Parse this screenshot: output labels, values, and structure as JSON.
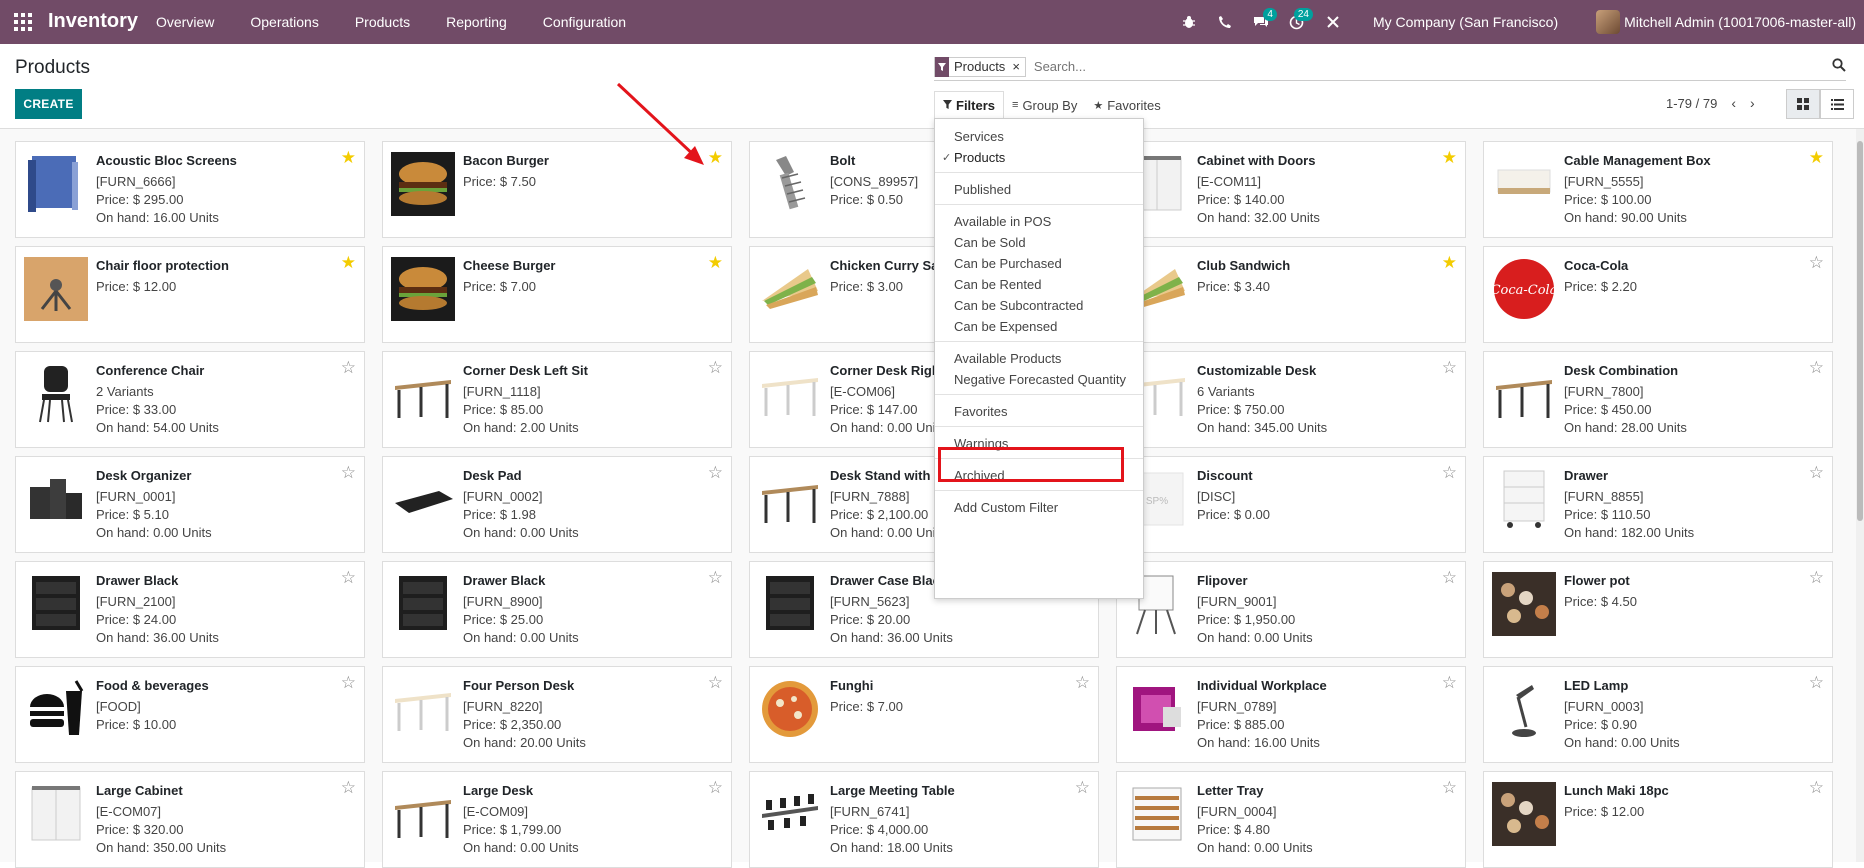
{
  "navbar": {
    "brand": "Inventory",
    "menu": [
      "Overview",
      "Operations",
      "Products",
      "Reporting",
      "Configuration"
    ],
    "badges": {
      "messages": "4",
      "activities": "24"
    },
    "company": "My Company (San Francisco)",
    "user": "Mitchell Admin (10017006-master-all)"
  },
  "page": {
    "title": "Products",
    "create_label": "CREATE"
  },
  "search": {
    "facet": "Products",
    "placeholder": "Search..."
  },
  "filter_bar": {
    "filters": "Filters",
    "group_by": "Group By",
    "favorites": "Favorites"
  },
  "pager": {
    "range": "1-79 / 79"
  },
  "filters_dropdown": {
    "groups": [
      [
        {
          "label": "Services",
          "checked": false
        },
        {
          "label": "Products",
          "checked": true
        }
      ],
      [
        {
          "label": "Published",
          "checked": false
        }
      ],
      [
        {
          "label": "Available in POS",
          "checked": false
        },
        {
          "label": "Can be Sold",
          "checked": false
        },
        {
          "label": "Can be Purchased",
          "checked": false
        },
        {
          "label": "Can be Rented",
          "checked": false
        },
        {
          "label": "Can be Subcontracted",
          "checked": false
        },
        {
          "label": "Can be Expensed",
          "checked": false
        }
      ],
      [
        {
          "label": "Available Products",
          "checked": false
        },
        {
          "label": "Negative Forecasted Quantity",
          "checked": false
        }
      ],
      [
        {
          "label": "Favorites",
          "checked": false
        }
      ],
      [
        {
          "label": "Warnings",
          "checked": false
        }
      ],
      [
        {
          "label": "Archived",
          "checked": false
        }
      ],
      [
        {
          "label": "Add Custom Filter",
          "checked": false
        }
      ]
    ]
  },
  "colors": {
    "navbar": "#714b67",
    "primary": "#017e84",
    "star": "#f3cc00",
    "highlight": "#e3141b"
  },
  "products": [
    [
      {
        "name": "Acoustic Bloc Screens",
        "lines": [
          "[FURN_6666]",
          "Price: $ 295.00",
          "On hand: 16.00 Units"
        ],
        "fav": true,
        "icon": "screen"
      },
      {
        "name": "Bacon Burger",
        "lines": [
          "Price: $ 7.50"
        ],
        "fav": true,
        "icon": "burger"
      },
      {
        "name": "Bolt",
        "lines": [
          "[CONS_89957]",
          "Price: $ 0.50"
        ],
        "fav": false,
        "icon": "bolt"
      },
      {
        "name": "Cabinet with Doors",
        "lines": [
          "[E-COM11]",
          "Price: $ 140.00",
          "On hand: 32.00 Units"
        ],
        "fav": true,
        "icon": "cabinet"
      },
      {
        "name": "Cable Management Box",
        "lines": [
          "[FURN_5555]",
          "Price: $ 100.00",
          "On hand: 90.00 Units"
        ],
        "fav": true,
        "icon": "box"
      }
    ],
    [
      {
        "name": "Chair floor protection",
        "lines": [
          "Price: $ 12.00"
        ],
        "fav": true,
        "icon": "mat"
      },
      {
        "name": "Cheese Burger",
        "lines": [
          "Price: $ 7.00"
        ],
        "fav": true,
        "icon": "burger"
      },
      {
        "name": "Chicken Curry Sandwich",
        "lines": [
          "Price: $ 3.00"
        ],
        "fav": false,
        "icon": "sandwich"
      },
      {
        "name": "Club Sandwich",
        "lines": [
          "Price: $ 3.40"
        ],
        "fav": true,
        "icon": "sandwich"
      },
      {
        "name": "Coca-Cola",
        "lines": [
          "Price: $ 2.20"
        ],
        "fav": false,
        "icon": "cola"
      }
    ],
    [
      {
        "name": "Conference Chair",
        "lines": [
          "2 Variants",
          "Price: $ 33.00",
          "On hand: 54.00 Units"
        ],
        "fav": false,
        "icon": "chair"
      },
      {
        "name": "Corner Desk Left Sit",
        "lines": [
          "[FURN_1118]",
          "Price: $ 85.00",
          "On hand: 2.00 Units"
        ],
        "fav": false,
        "icon": "desk"
      },
      {
        "name": "Corner Desk Right Sit",
        "lines": [
          "[E-COM06]",
          "Price: $ 147.00",
          "On hand: 0.00 Units"
        ],
        "fav": false,
        "icon": "desk-light"
      },
      {
        "name": "Customizable Desk",
        "lines": [
          "6 Variants",
          "Price: $ 750.00",
          "On hand: 345.00 Units"
        ],
        "fav": false,
        "icon": "desk-light"
      },
      {
        "name": "Desk Combination",
        "lines": [
          "[FURN_7800]",
          "Price: $ 450.00",
          "On hand: 28.00 Units"
        ],
        "fav": false,
        "icon": "desk"
      }
    ],
    [
      {
        "name": "Desk Organizer",
        "lines": [
          "[FURN_0001]",
          "Price: $ 5.10",
          "On hand: 0.00 Units"
        ],
        "fav": false,
        "icon": "organizer"
      },
      {
        "name": "Desk Pad",
        "lines": [
          "[FURN_0002]",
          "Price: $ 1.98",
          "On hand: 0.00 Units"
        ],
        "fav": false,
        "icon": "pad"
      },
      {
        "name": "Desk Stand with Screen",
        "lines": [
          "[FURN_7888]",
          "Price: $ 2,100.00",
          "On hand: 0.00 Units"
        ],
        "fav": false,
        "icon": "desk"
      },
      {
        "name": "Discount",
        "lines": [
          "[DISC]",
          "Price: $ 0.00"
        ],
        "fav": false,
        "icon": "discount"
      },
      {
        "name": "Drawer",
        "lines": [
          "[FURN_8855]",
          "Price: $ 110.50",
          "On hand: 182.00 Units"
        ],
        "fav": false,
        "icon": "drawer"
      }
    ],
    [
      {
        "name": "Drawer Black",
        "lines": [
          "[FURN_2100]",
          "Price: $ 24.00",
          "On hand: 36.00 Units"
        ],
        "fav": false,
        "icon": "drawer-black"
      },
      {
        "name": "Drawer Black",
        "lines": [
          "[FURN_8900]",
          "Price: $ 25.00",
          "On hand: 0.00 Units"
        ],
        "fav": false,
        "icon": "drawer-black"
      },
      {
        "name": "Drawer Case Black",
        "lines": [
          "[FURN_5623]",
          "Price: $ 20.00",
          "On hand: 36.00 Units"
        ],
        "fav": false,
        "icon": "drawer-black"
      },
      {
        "name": "Flipover",
        "lines": [
          "[FURN_9001]",
          "Price: $ 1,950.00",
          "On hand: 0.00 Units"
        ],
        "fav": false,
        "icon": "flipover"
      },
      {
        "name": "Flower pot",
        "lines": [
          "Price: $ 4.50"
        ],
        "fav": false,
        "icon": "food"
      }
    ],
    [
      {
        "name": "Food & beverages",
        "lines": [
          "[FOOD]",
          "Price: $ 10.00"
        ],
        "fav": false,
        "icon": "food-icon"
      },
      {
        "name": "Four Person Desk",
        "lines": [
          "[FURN_8220]",
          "Price: $ 2,350.00",
          "On hand: 20.00 Units"
        ],
        "fav": false,
        "icon": "desk-light"
      },
      {
        "name": "Funghi",
        "lines": [
          "Price: $ 7.00"
        ],
        "fav": false,
        "icon": "pizza"
      },
      {
        "name": "Individual Workplace",
        "lines": [
          "[FURN_0789]",
          "Price: $ 885.00",
          "On hand: 16.00 Units"
        ],
        "fav": false,
        "icon": "workplace"
      },
      {
        "name": "LED Lamp",
        "lines": [
          "[FURN_0003]",
          "Price: $ 0.90",
          "On hand: 0.00 Units"
        ],
        "fav": false,
        "icon": "lamp"
      }
    ],
    [
      {
        "name": "Large Cabinet",
        "lines": [
          "[E-COM07]",
          "Price: $ 320.00",
          "On hand: 350.00 Units"
        ],
        "fav": false,
        "icon": "cabinet"
      },
      {
        "name": "Large Desk",
        "lines": [
          "[E-COM09]",
          "Price: $ 1,799.00",
          "On hand: 0.00 Units"
        ],
        "fav": false,
        "icon": "desk"
      },
      {
        "name": "Large Meeting Table",
        "lines": [
          "[FURN_6741]",
          "Price: $ 4,000.00",
          "On hand: 18.00 Units"
        ],
        "fav": false,
        "icon": "table"
      },
      {
        "name": "Letter Tray",
        "lines": [
          "[FURN_0004]",
          "Price: $ 4.80",
          "On hand: 0.00 Units"
        ],
        "fav": false,
        "icon": "tray"
      },
      {
        "name": "Lunch Maki 18pc",
        "lines": [
          "Price: $ 12.00"
        ],
        "fav": false,
        "icon": "food"
      }
    ]
  ]
}
